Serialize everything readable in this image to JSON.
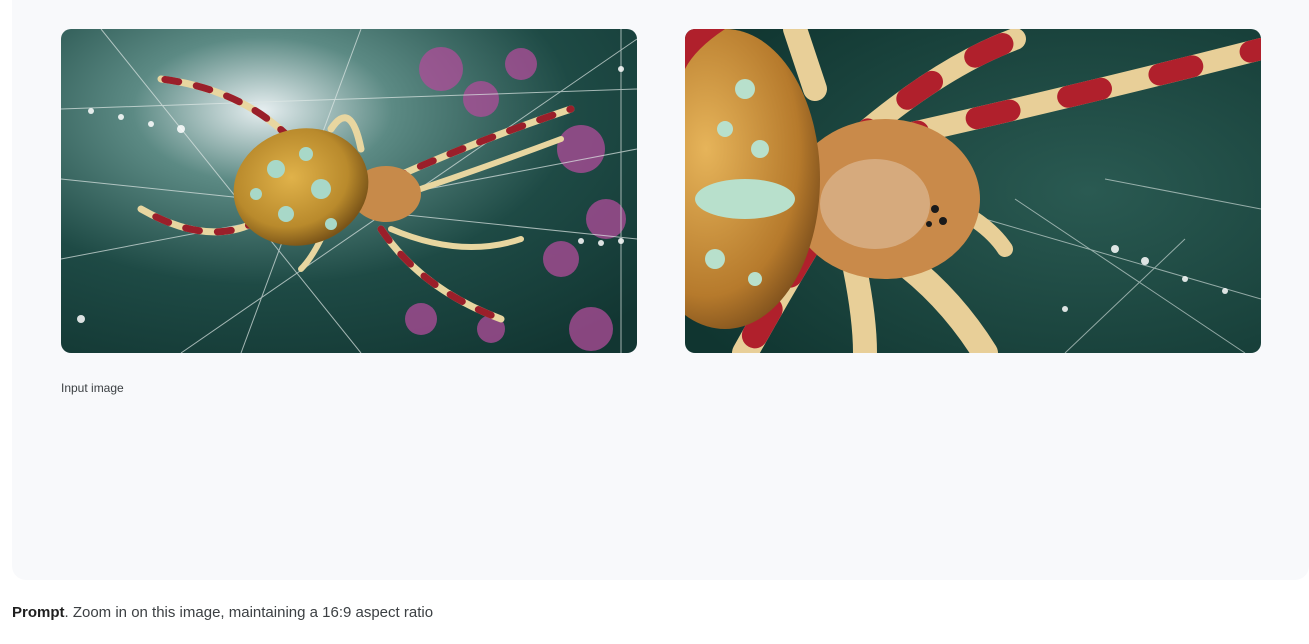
{
  "images": {
    "input": {
      "subject": "orb-weaver spider on dew-covered web",
      "colors": {
        "background": "#1d4a44",
        "flowers": "#b04c9a",
        "body": "#c89a3a",
        "spots": "#a8d8c8",
        "leg_band": "#9a1f2a"
      }
    },
    "output": {
      "subject": "zoomed orb-weaver spider detail",
      "colors": {
        "background": "#15403b",
        "body": "#c98a4a",
        "spots": "#b8e0cc",
        "leg_band": "#b0202c"
      }
    }
  },
  "caption": "Input image",
  "prompt": {
    "label": "Prompt",
    "separator": ".",
    "text": " Zoom in on this image, maintaining a 16:9 aspect ratio"
  }
}
